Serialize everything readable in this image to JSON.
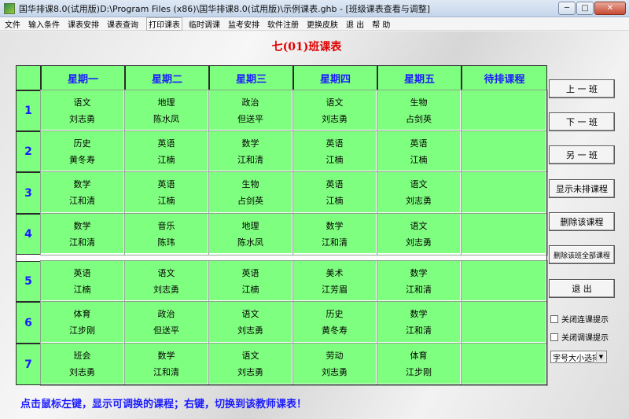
{
  "window": {
    "title": "国华排课8.0(试用版)D:\\Program Files (x86)\\国华排课8.0(试用版)\\示例课表.ghb - [班级课表查看与调整]",
    "minimize": "─",
    "maximize": "□",
    "close": "✕"
  },
  "menu": [
    "文件",
    "输入条件",
    "课表安排",
    "课表查询",
    "打印课表",
    "临时调课",
    "监考安排",
    "软件注册",
    "更换皮肤",
    "退 出",
    "帮 助"
  ],
  "class_title": "七(01)班课表",
  "columns": [
    "星期一",
    "星期二",
    "星期三",
    "星期四",
    "星期五",
    "待排课程"
  ],
  "periods": [
    "1",
    "2",
    "3",
    "4",
    "5",
    "6",
    "7"
  ],
  "schedule": [
    [
      [
        "语文",
        "刘志勇"
      ],
      [
        "地理",
        "陈水凤"
      ],
      [
        "政治",
        "但送平"
      ],
      [
        "语文",
        "刘志勇"
      ],
      [
        "生物",
        "占剑英"
      ]
    ],
    [
      [
        "历史",
        "黄冬寿"
      ],
      [
        "英语",
        "江楠"
      ],
      [
        "数学",
        "江和清"
      ],
      [
        "英语",
        "江楠"
      ],
      [
        "英语",
        "江楠"
      ]
    ],
    [
      [
        "数学",
        "江和清"
      ],
      [
        "英语",
        "江楠"
      ],
      [
        "生物",
        "占剑英"
      ],
      [
        "英语",
        "江楠"
      ],
      [
        "语文",
        "刘志勇"
      ]
    ],
    [
      [
        "数学",
        "江和清"
      ],
      [
        "音乐",
        "陈玮"
      ],
      [
        "地理",
        "陈水凤"
      ],
      [
        "数学",
        "江和清"
      ],
      [
        "语文",
        "刘志勇"
      ]
    ],
    [
      [
        "英语",
        "江楠"
      ],
      [
        "语文",
        "刘志勇"
      ],
      [
        "英语",
        "江楠"
      ],
      [
        "美术",
        "江芳眉"
      ],
      [
        "数学",
        "江和清"
      ]
    ],
    [
      [
        "体育",
        "江步刚"
      ],
      [
        "政治",
        "但送平"
      ],
      [
        "语文",
        "刘志勇"
      ],
      [
        "历史",
        "黄冬寿"
      ],
      [
        "数学",
        "江和清"
      ]
    ],
    [
      [
        "班会",
        "刘志勇"
      ],
      [
        "数学",
        "江和清"
      ],
      [
        "语文",
        "刘志勇"
      ],
      [
        "劳动",
        "刘志勇"
      ],
      [
        "体育",
        "江步刚"
      ]
    ]
  ],
  "buttons": {
    "prev": "上 一 班",
    "next": "下 一 班",
    "other": "另 一 班",
    "show_unscheduled": "显示未排课程",
    "delete_course": "删除该课程",
    "delete_all": "删除该班全部课程",
    "exit": "退 出"
  },
  "checkboxes": {
    "close_consecutive": "关闭连课提示",
    "close_swap": "关闭调课提示"
  },
  "font_select": "字号大小选择",
  "hint": "点击鼠标左键，显示可调换的课程；右键，切换到该教师课表！"
}
